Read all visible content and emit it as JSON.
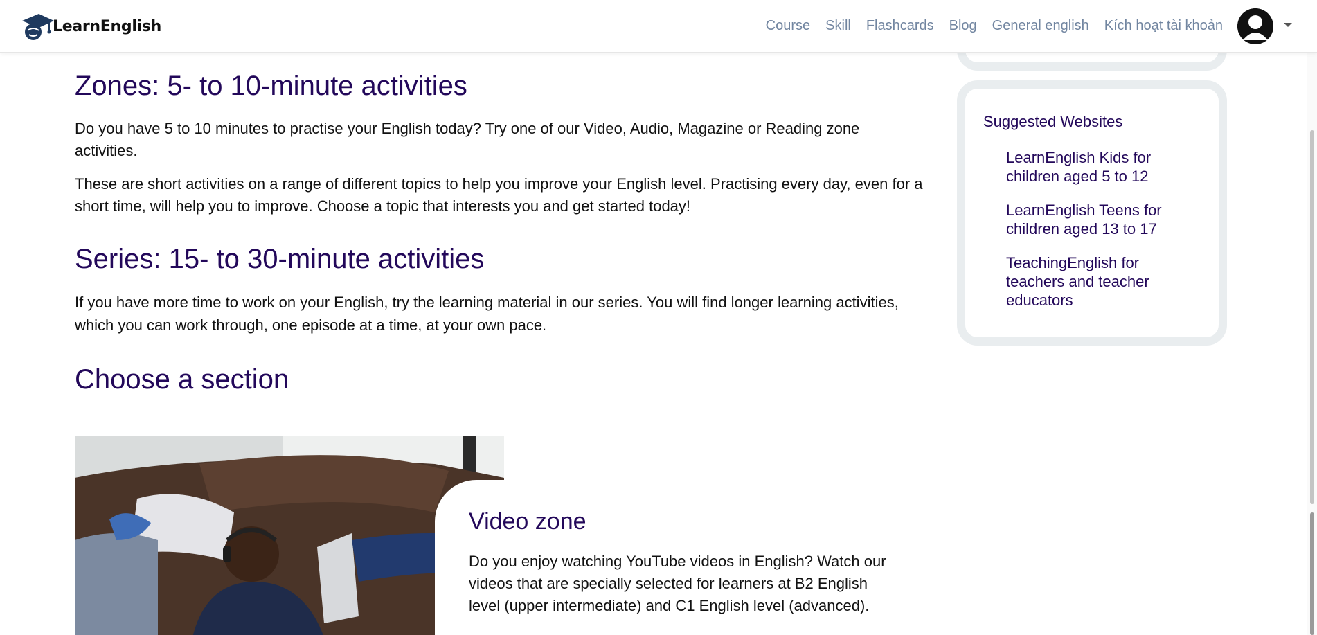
{
  "header": {
    "logo_text": "LearnEnglish",
    "nav": [
      "Course",
      "Skill",
      "Flashcards",
      "Blog",
      "General english",
      "Kích hoạt tài khoản"
    ]
  },
  "main": {
    "zones_heading": "Zones: 5- to 10-minute activities",
    "zones_p1": "Do you have 5 to 10 minutes to practise your English today? Try one of our Video, Audio, Magazine or Reading zone activities.",
    "zones_p2": "These are short activities on a range of different topics to help you improve your English level. Practising every day, even for a short time, will help you to improve. Choose a topic that interests you and get started today!",
    "series_heading": "Series: 15- to 30-minute activities",
    "series_p": "If you have more time to work on your English, try the learning material in our series. You will find longer learning activities, which you can work through, one episode at a time, at your own pace.",
    "choose_heading": "Choose a section",
    "card": {
      "title": "Video zone",
      "text": "Do you enjoy watching YouTube videos in English? Watch our videos that are specially selected for learners at B2 English level (upper intermediate) and C1 English level (advanced)."
    }
  },
  "sidebar": {
    "title": "Suggested Websites",
    "links": [
      "LearnEnglish Kids for children aged 5 to 12",
      "LearnEnglish Teens for children aged 13 to 17",
      "TeachingEnglish for teachers and teacher educators"
    ]
  },
  "colors": {
    "heading": "#23085a",
    "nav": "#7185a0",
    "sidebar_border": "#e9edef"
  },
  "icons": [
    "logo-graduation-cap-icon",
    "user-avatar-icon",
    "chevron-down-icon"
  ]
}
